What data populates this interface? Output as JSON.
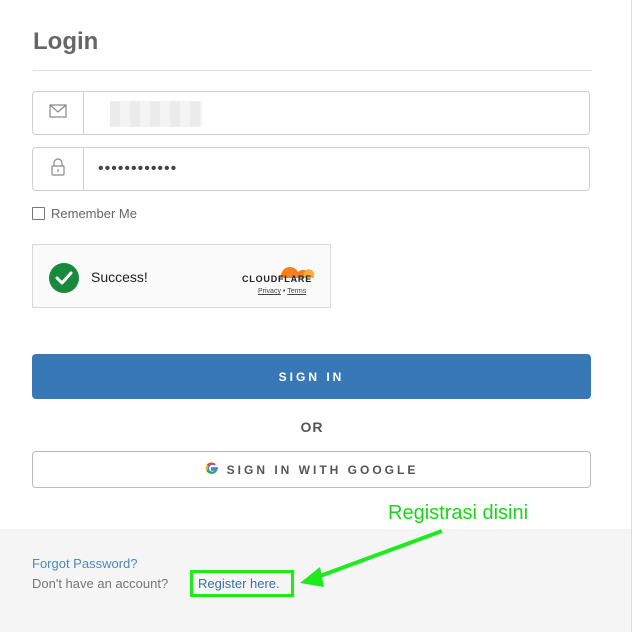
{
  "login": {
    "title": "Login",
    "email_value": "",
    "password_value": "••••••••••••",
    "remember_label": "Remember Me"
  },
  "captcha": {
    "status": "Success!",
    "brand": "CLOUDFLARE",
    "privacy": "Privacy",
    "separator": "•",
    "terms": "Terms"
  },
  "buttons": {
    "signin": "SIGN IN",
    "or": "OR",
    "google": "SIGN IN WITH GOOGLE"
  },
  "footer": {
    "forgot": "Forgot Password?",
    "no_account": "Don't have an account?",
    "register": "Register here."
  },
  "annotation": {
    "text": "Registrasi disini",
    "color": "#1eea1e"
  },
  "icons": {
    "email": "envelope-icon",
    "password": "lock-icon",
    "success": "checkmark-icon",
    "google": "google-g-icon",
    "cloudflare": "cloud-icon"
  },
  "colors": {
    "primary": "#3878b6",
    "success": "#178a3d",
    "link": "#4f86c6",
    "annotation": "#1eea1e"
  }
}
